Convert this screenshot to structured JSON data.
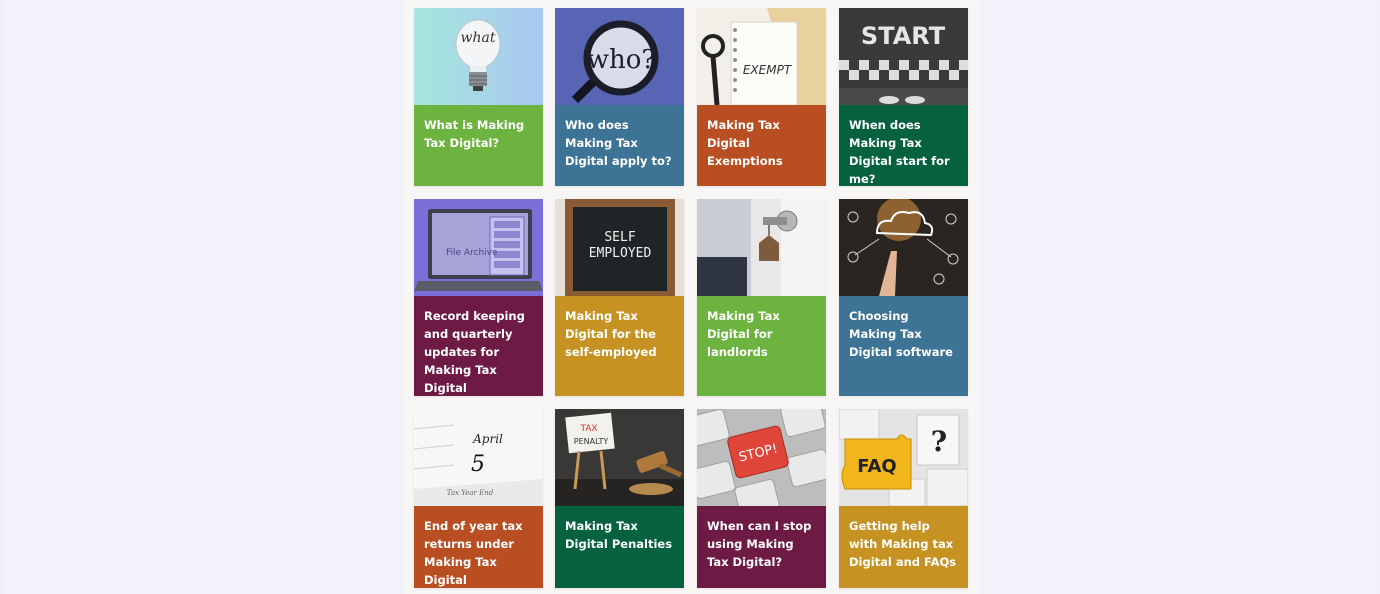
{
  "cards": [
    {
      "title": "What is Making Tax Digital?",
      "image_text": "what",
      "color": "#6db33f"
    },
    {
      "title": "Who does Making Tax Digital apply to?",
      "image_text": "who?",
      "color": "#3d7395"
    },
    {
      "title": "Making Tax Digital Exemptions",
      "image_text": "EXEMPT",
      "color": "#b84e22"
    },
    {
      "title": "When does Making Tax Digital start for me?",
      "image_text": "START",
      "color": "#06613f"
    },
    {
      "title": "Record keeping and quarterly updates for Making Tax Digital",
      "image_text": "File Archive",
      "color": "#6d1a45"
    },
    {
      "title": "Making Tax Digital for the self-employed",
      "image_text_1": "SELF",
      "image_text_2": "EMPLOYED",
      "color": "#c69323"
    },
    {
      "title": "Making Tax Digital for landlords",
      "color": "#6db33f"
    },
    {
      "title": "Choosing Making Tax Digital software",
      "color": "#3d7395"
    },
    {
      "title": "End of year tax returns under Making Tax Digital",
      "image_text_1": "April",
      "image_text_2": "5",
      "image_text_3": "Tax Year End",
      "color": "#b84e22"
    },
    {
      "title": "Making Tax Digital Penalties",
      "image_text_1": "TAX",
      "image_text_2": "PENALTY",
      "color": "#06613f"
    },
    {
      "title": "When can I stop using Making Tax Digital?",
      "image_text": "STOP!",
      "color": "#6d1a45"
    },
    {
      "title": "Getting help with Making tax Digital and FAQs",
      "image_text_1": "FAQ",
      "image_text_2": "?",
      "color": "#c69323"
    }
  ]
}
